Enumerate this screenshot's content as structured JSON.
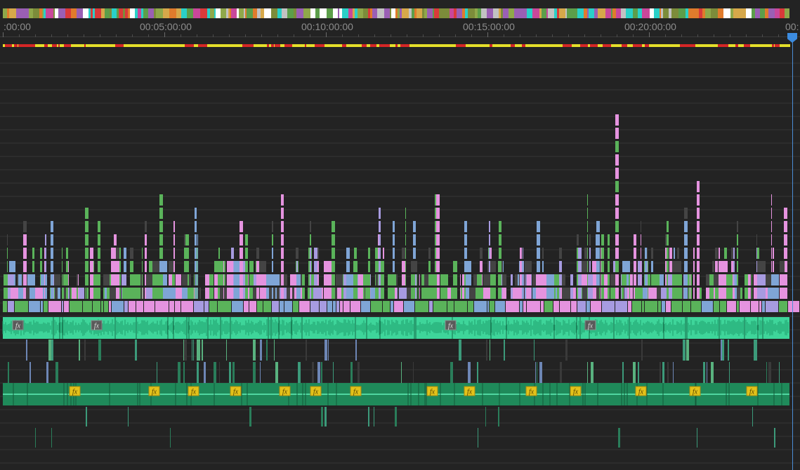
{
  "ruler": {
    "labels": [
      ":00:00",
      "00:05:00:00",
      "00:10:00:00",
      "00:15:00:00",
      "00:20:00:00",
      "00:"
    ]
  },
  "colors": {
    "background": "#232323",
    "track_line": "#343434",
    "video_pink": "#e593df",
    "video_green": "#5ab35a",
    "video_blue": "#7fa5d6",
    "video_lavender": "#a79be0",
    "audio_teal": "#3ed59a",
    "audio_dark_green": "#1f8a5a",
    "render_yellow": "#e4df2a",
    "render_red": "#d42626",
    "playhead": "#3c8ce0",
    "fx_badge": "#e3c21a"
  },
  "icons": {
    "fx": "fx",
    "playhead": "playhead-icon"
  },
  "audio_track_1": {
    "fx_badges": [
      "fx",
      "fx",
      "fx",
      "fx"
    ]
  },
  "audio_track_2": {
    "fx_badges": [
      "fx",
      "fx",
      "fx",
      "fx",
      "fx",
      "fx",
      "fx",
      "fx",
      "fx",
      "fx",
      "fx",
      "fx",
      "fx",
      "fx",
      "fx"
    ]
  }
}
